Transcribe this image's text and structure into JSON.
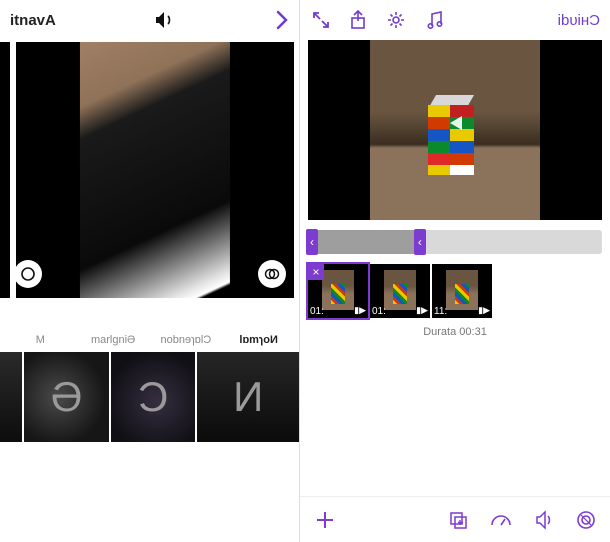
{
  "colors": {
    "accent": "#6f3dcf"
  },
  "left": {
    "back_label": "itnavA",
    "filters": {
      "labels": [
        "M",
        "marlgniƏ",
        "nobnɘɿɒlϽ",
        "lɒmɿoИ"
      ],
      "active_index": 3,
      "letters": [
        "",
        "Ә",
        "Ͻ",
        "И"
      ]
    }
  },
  "right": {
    "close_label": "ibυiʜϽ",
    "thumbs": [
      {
        "duration": "01:",
        "selected": true,
        "removable": true
      },
      {
        "duration": "01:",
        "selected": false,
        "removable": false
      },
      {
        "duration": "11:",
        "selected": false,
        "removable": false
      }
    ],
    "total_label": "Durata",
    "total_value": "00:31"
  }
}
